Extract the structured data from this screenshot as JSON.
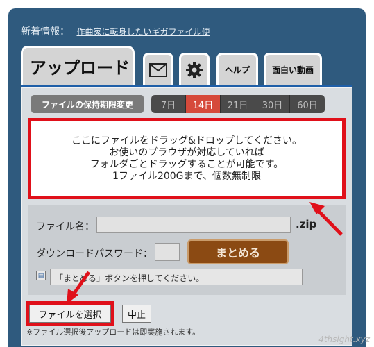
{
  "header": {
    "news_label": "新着情報：",
    "news_link": "作曲家に転身したいギガファイル便"
  },
  "tabs": {
    "upload": "アップロード",
    "mail_icon": "envelope-icon",
    "settings_icon": "gear-icon",
    "help": "ヘルプ",
    "funny_video": "面白い動画"
  },
  "retention": {
    "label": "ファイルの保持期限変更",
    "periods": [
      "7日",
      "14日",
      "21日",
      "30日",
      "60日"
    ],
    "active_index": 1
  },
  "dropzone": {
    "lines": [
      "ここにファイルをドラッグ&ドロップしてください。",
      "お使いのブラウザが対応していれば",
      "フォルダごとドラッグすることが可能です。",
      "1ファイル200Gまで、個数無制限"
    ]
  },
  "form": {
    "filename_label": "ファイル名：",
    "filename_value": "",
    "extension": ".zip",
    "password_label": "ダウンロードパスワード：",
    "password_value": "",
    "merge_button": "まとめる",
    "status_text": "「まとめる」ボタンを押してください。"
  },
  "actions": {
    "select_file": "ファイルを選択",
    "stop": "中止",
    "note": "※ファイル選択後アップロードは即実施されます。"
  },
  "watermark": "4thsight.xyz",
  "colors": {
    "frame": "#2f5a7e",
    "highlight_red": "#e0101a",
    "merge_button": "#8b4a13",
    "active_period": "#d64a3b"
  }
}
